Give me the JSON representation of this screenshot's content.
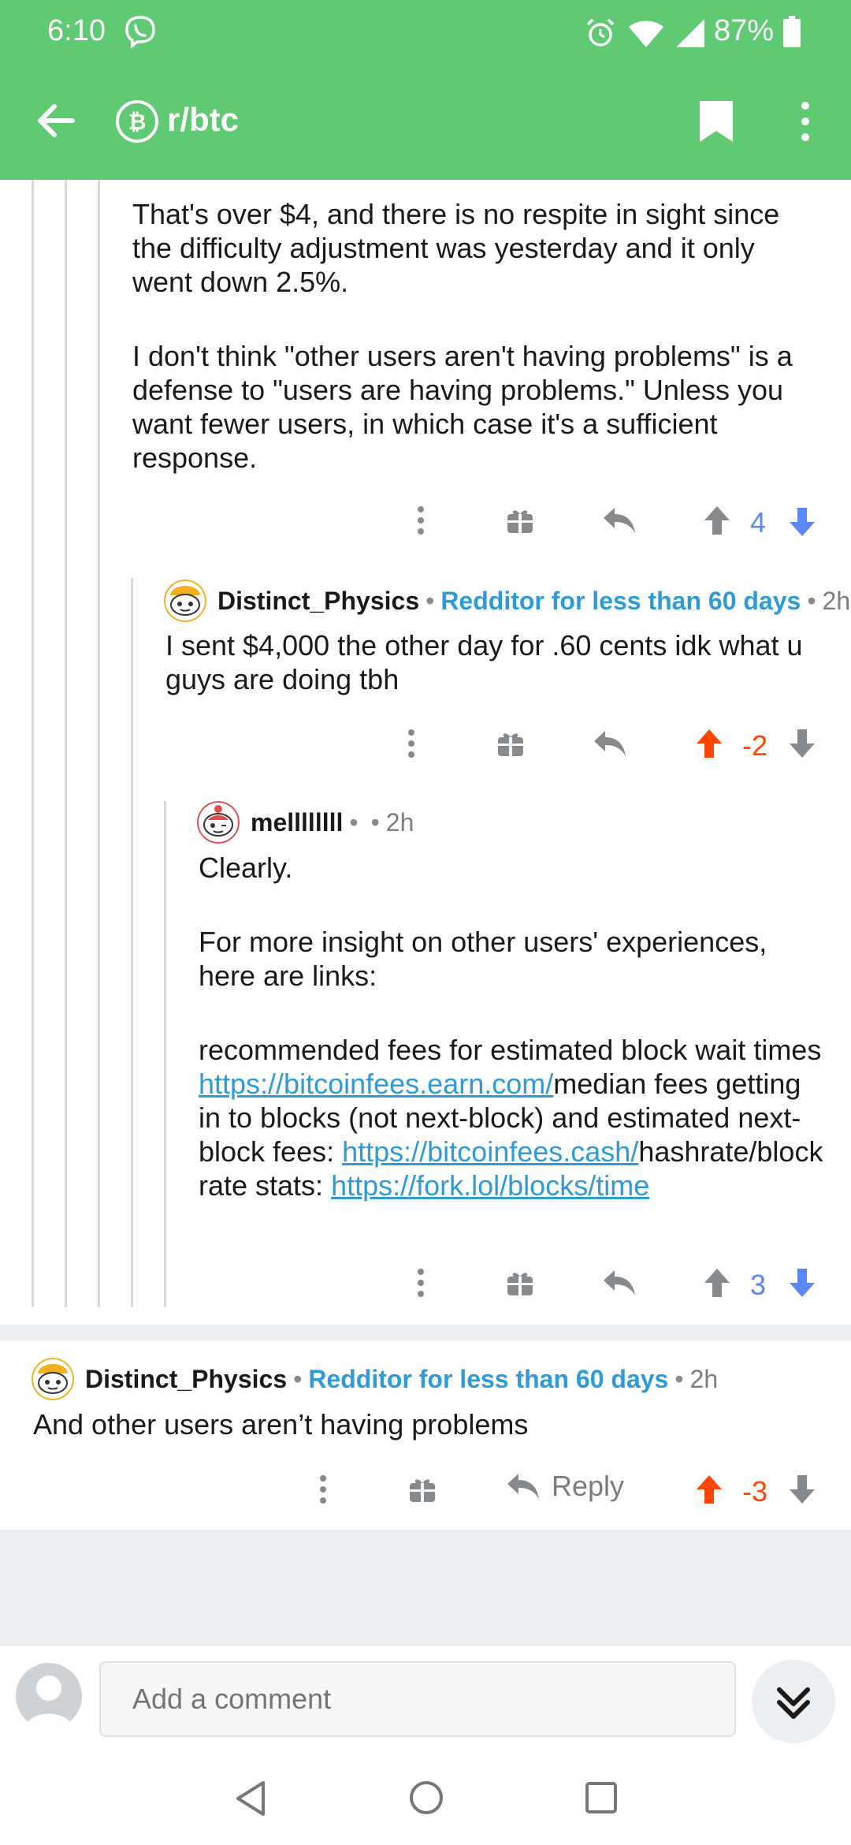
{
  "status_bar": {
    "time": "6:10",
    "battery": "87%"
  },
  "app_bar": {
    "subreddit": "r/btc"
  },
  "comments": [
    {
      "paragraphs": [
        "That's over $4, and there is no respite in sight since the difficulty adjustment was yesterday and it only went down 2.5%.",
        "I don't think \"other users aren't having problems\" is a defense to \"users are having problems.\" Unless you want fewer users, in which case it's a sufficient response."
      ],
      "score": "4"
    },
    {
      "author": "Distinct_Physics",
      "separator": "•",
      "flair": "Redditor for less than 60 days",
      "age": "2h",
      "text": "I sent $4,000 the other day for .60 cents idk what u guys are doing tbh",
      "score": "-2"
    },
    {
      "author": "mellllllll",
      "separator": "•",
      "age": "2h",
      "text_1": "Clearly.",
      "text_2": "For more insight on other users' experiences, here are links:",
      "text_3a": "recommended fees for estimated block wait times ",
      "link_1": "https://bitcoinfees.earn.com/",
      "text_3b": "median fees getting in to blocks (not next-block) and estimated next-block fees: ",
      "link_2": "https://bitcoinfees.cash/",
      "text_3c": "hashrate/block rate stats: ",
      "link_3": "https://fork.lol/blocks/time",
      "score": "3"
    },
    {
      "author": "Distinct_Physics",
      "separator": "•",
      "flair": "Redditor for less than 60 days",
      "age": "2h",
      "text": "And other users aren’t having problems",
      "reply_label": "Reply",
      "score": "-3"
    }
  ],
  "composer": {
    "placeholder": "Add a comment"
  },
  "colors": {
    "header_green": "#5fc973",
    "flair_blue": "#2e9bd6",
    "upvote_orange": "#ff4500",
    "downvote_blue": "#5b86f5"
  }
}
